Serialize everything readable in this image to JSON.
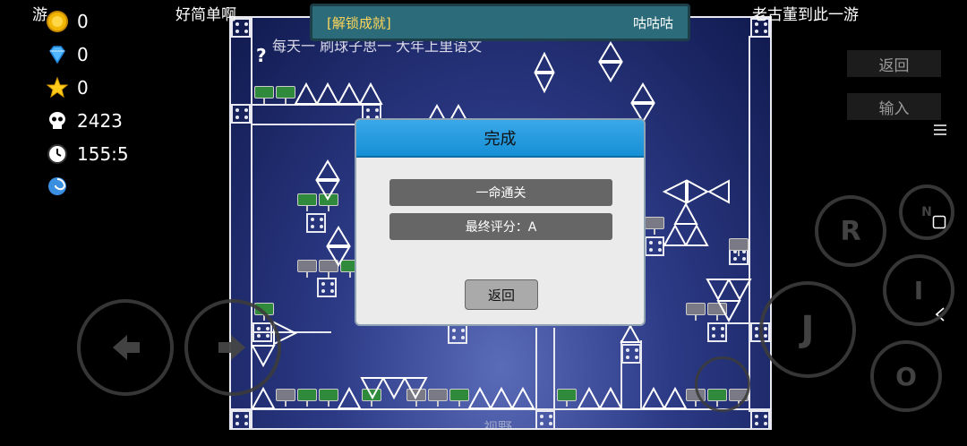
{
  "hud": {
    "coins": "0",
    "diamonds": "0",
    "stars": "0",
    "deaths": "2423",
    "time": "155:5"
  },
  "top": {
    "left_fragment": "游",
    "title_left": "好简单啊",
    "title_right": "老古董到此一游"
  },
  "toast": {
    "title": "[解锁成就]",
    "name": "咕咕咕"
  },
  "playfield": {
    "hint_mark": "?",
    "banner_text": "每天一 刷球子思一 大年上里语文",
    "bottom_label": "视野"
  },
  "dialog": {
    "title": "完成",
    "item1": "一命通关",
    "item2": "最终评分：A",
    "back_button": "返回"
  },
  "side": {
    "back_label": "返回",
    "input_label": "输入",
    "menu_icon": "hamburger-icon"
  },
  "controls": {
    "r": "R",
    "n": "N",
    "i": "I",
    "j": "J",
    "o": "O"
  },
  "colors": {
    "toast_title": "#ffd75a",
    "dialog_header": "#168fd6",
    "sign_green": "#2f8a3b"
  }
}
